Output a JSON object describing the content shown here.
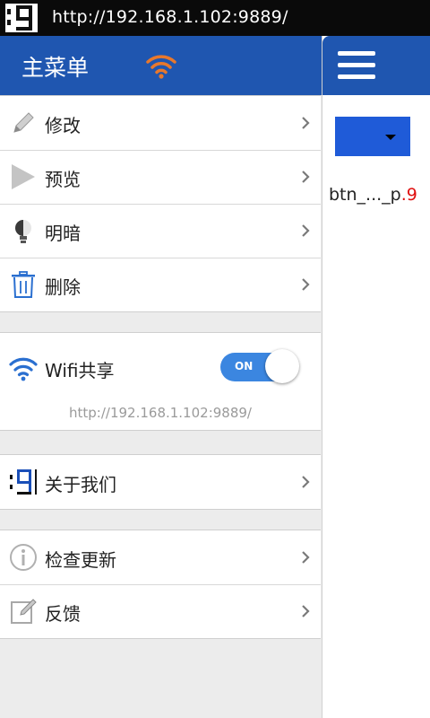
{
  "status_bar": {
    "url": "http://192.168.1.102:9889/"
  },
  "drawer": {
    "title": "主菜单",
    "items_group1": [
      {
        "label": "修改",
        "icon": "pencil-icon"
      },
      {
        "label": "预览",
        "icon": "play-icon"
      },
      {
        "label": "明暗",
        "icon": "bulb-icon"
      },
      {
        "label": "删除",
        "icon": "trash-icon"
      }
    ],
    "wifi": {
      "label": "Wifi共享",
      "toggle_label": "ON",
      "toggle_on": true,
      "url": "http://192.168.1.102:9889/"
    },
    "items_group3": [
      {
        "label": "关于我们",
        "icon": "app-logo-icon"
      }
    ],
    "items_group4": [
      {
        "label": "检查更新",
        "icon": "info-icon"
      },
      {
        "label": "反馈",
        "icon": "edit-note-icon"
      }
    ]
  },
  "content": {
    "button_text_main": "btn_..._p",
    "button_text_suffix": ".9"
  },
  "colors": {
    "header_blue": "#1f56b0",
    "toggle_blue": "#3b86e0",
    "wifi_orange": "#e8782c"
  }
}
